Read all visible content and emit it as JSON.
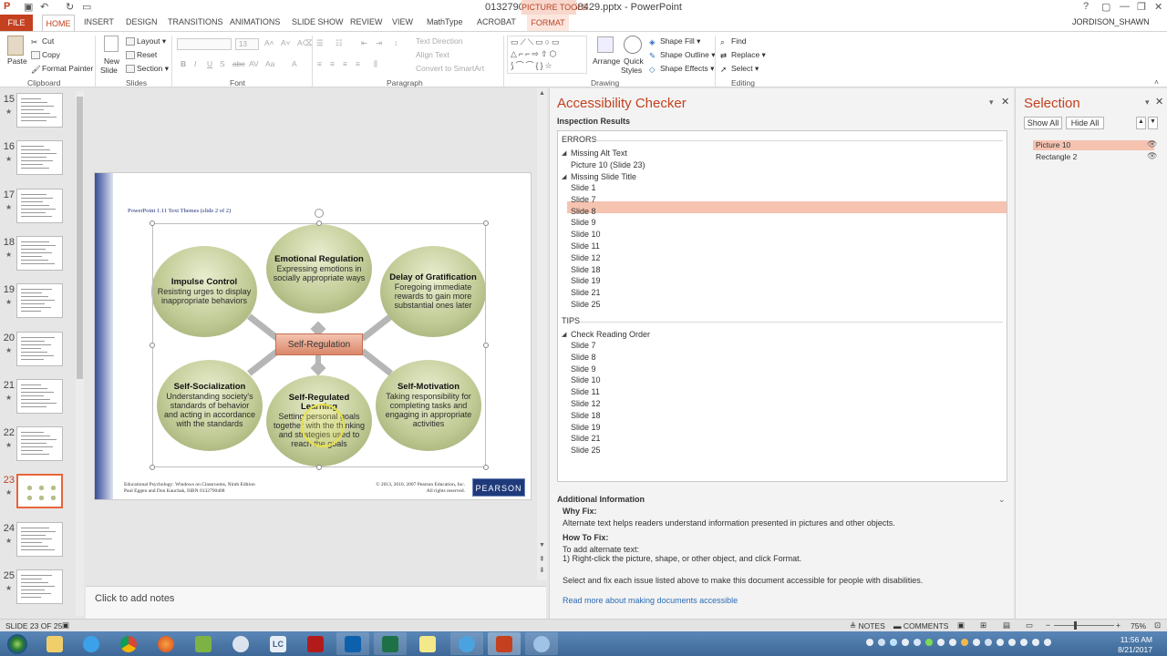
{
  "window": {
    "title": "0132790408_pp1-158429.pptx - PowerPoint",
    "picture_tools": "PICTURE TOOLS",
    "user": "JORDISON_SHAWN",
    "help_glyph": "?"
  },
  "tabs": {
    "file": "FILE",
    "home": "HOME",
    "items": [
      "INSERT",
      "DESIGN",
      "TRANSITIONS",
      "ANIMATIONS",
      "SLIDE SHOW",
      "REVIEW",
      "VIEW",
      "MathType",
      "ACROBAT"
    ],
    "format": "FORMAT"
  },
  "ribbon": {
    "clipboard": {
      "label": "Clipboard",
      "paste": "Paste",
      "cut": "Cut",
      "copy": "Copy",
      "format_painter": "Format Painter"
    },
    "slides": {
      "label": "Slides",
      "new_slide": "New",
      "new_slide2": "Slide",
      "layout": "Layout",
      "reset": "Reset",
      "section": "Section"
    },
    "font": {
      "label": "Font",
      "size": "13"
    },
    "paragraph": {
      "label": "Paragraph",
      "text_direction": "Text Direction",
      "align_text": "Align Text",
      "smartart": "Convert to SmartArt"
    },
    "drawing": {
      "label": "Drawing",
      "arrange": "Arrange",
      "quick_styles": "Quick",
      "quick_styles2": "Styles",
      "shape_fill": "Shape Fill",
      "shape_outline": "Shape Outline",
      "shape_effects": "Shape Effects"
    },
    "editing": {
      "label": "Editing",
      "find": "Find",
      "replace": "Replace",
      "select": "Select"
    }
  },
  "thumbnails": [
    {
      "num": "15"
    },
    {
      "num": "16"
    },
    {
      "num": "17"
    },
    {
      "num": "18"
    },
    {
      "num": "19"
    },
    {
      "num": "20"
    },
    {
      "num": "21"
    },
    {
      "num": "22"
    },
    {
      "num": "23",
      "selected": true
    },
    {
      "num": "24"
    },
    {
      "num": "25"
    }
  ],
  "slide": {
    "heading": "PowerPoint 1.11 Text Themes (slide 2 of 2)",
    "center": "Self-Regulation",
    "circles": [
      {
        "title": "Emotional Regulation",
        "body": "Expressing emotions in socially appropriate ways"
      },
      {
        "title": "Impulse Control",
        "body": "Resisting urges to display inappropriate behaviors"
      },
      {
        "title": "Delay of Gratification",
        "body": "Foregoing immediate rewards to gain more substantial ones later"
      },
      {
        "title": "Self-Socialization",
        "body": "Understanding society's standards of behavior and acting in accordance with the standards"
      },
      {
        "title": "Self-Regulated Learning",
        "body": "Setting personal goals together with the thinking and strategies used to reach the goals"
      },
      {
        "title": "Self-Motivation",
        "body": "Taking responsibility for completing tasks and engaging in appropriate activities"
      }
    ],
    "footer_left_1": "Educational Psychology: Windows on Classrooms, Ninth Edition",
    "footer_left_2": "Paul Eggen and Don Kauchak, ISBN 0132790408",
    "footer_right_1": "© 2013, 2010, 2007 Pearson Education, Inc.",
    "footer_right_2": "All rights reserved.",
    "logo": "PEARSON"
  },
  "notes_placeholder": "Click to add notes",
  "accessibility": {
    "title": "Accessibility Checker",
    "inspection": "Inspection Results",
    "errors_label": "ERRORS",
    "missing_alt": "Missing Alt Text",
    "missing_alt_items": [
      "Picture 10  (Slide 23)"
    ],
    "missing_title": "Missing Slide Title",
    "missing_title_items": [
      "Slide 1",
      "Slide 7",
      "Slide 8",
      "Slide 9",
      "Slide 10",
      "Slide 11",
      "Slide 12",
      "Slide 18",
      "Slide 19",
      "Slide 21",
      "Slide 25"
    ],
    "tips_label": "TIPS",
    "reading_order": "Check Reading Order",
    "reading_order_items": [
      "Slide 7",
      "Slide 8",
      "Slide 9",
      "Slide 10",
      "Slide 11",
      "Slide 12",
      "Slide 18",
      "Slide 19",
      "Slide 21",
      "Slide 25"
    ],
    "additional": "Additional Information",
    "why_fix": "Why Fix:",
    "why_text": "Alternate text helps readers understand information presented in pictures and other objects.",
    "how_fix": "How To Fix:",
    "how_text_1": "To add alternate text:",
    "how_text_2": "1) Right-click the picture, shape, or other object, and click Format.",
    "select_fix": "Select and fix each issue listed above to make this document accessible for people with disabilities.",
    "read_more": "Read more about making documents accessible"
  },
  "selection": {
    "title": "Selection",
    "show_all": "Show All",
    "hide_all": "Hide All",
    "items": [
      "Picture 10",
      "Rectangle 2"
    ]
  },
  "status": {
    "slide": "SLIDE 23 OF 25",
    "notes": "NOTES",
    "comments": "COMMENTS",
    "zoom": "75%"
  },
  "taskbar": {
    "time": "11:56 AM",
    "date": "8/21/2017",
    "lc_label": "LC"
  },
  "colors": {
    "accent": "#c4401f",
    "highlight": "#f6c3b1"
  }
}
